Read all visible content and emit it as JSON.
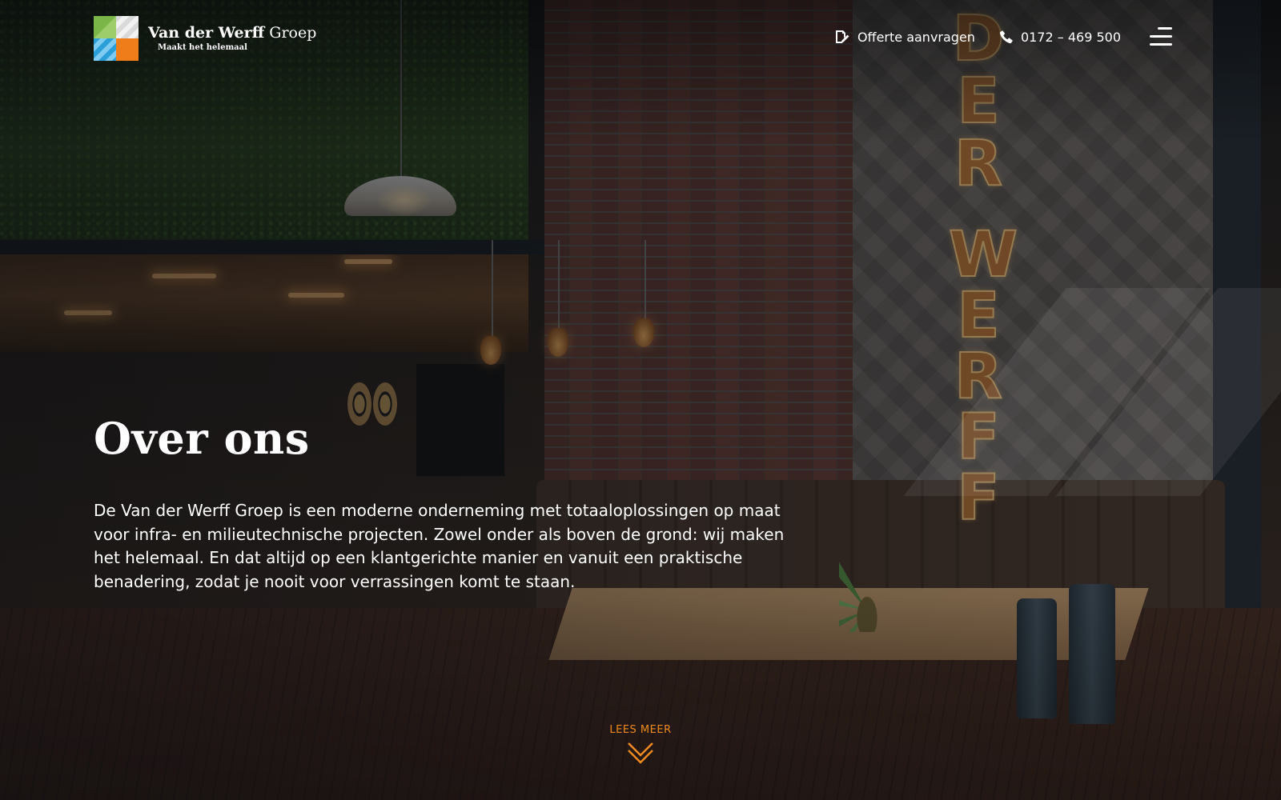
{
  "brand": {
    "name_bold": "Van der Werff",
    "name_regular": "Groep",
    "tagline": "Maakt het helemaal"
  },
  "nav": {
    "quote_label": "Offerte aanvragen",
    "quote_icon": "edit-document-icon",
    "phone_label": "0172 – 469 500",
    "phone_icon": "phone-icon",
    "menu_icon": "hamburger-menu-icon"
  },
  "hero": {
    "title": "Over ons",
    "intro": "De Van der Werff Groep is een moderne onderneming met totaaloplossingen op maat voor infra- en milieutechnische projecten. Zowel onder als boven de grond: wij maken het helemaal. En dat altijd op een klantgerichte manier en vanuit een praktische benadering, zodat je nooit voor verrassingen komt te staan.",
    "read_more_label": "LEES MEER",
    "read_more_icon": "double-chevron-down-icon"
  },
  "background_sign": {
    "word1": [
      "D",
      "E",
      "R"
    ],
    "word2": [
      "W",
      "E",
      "R",
      "F",
      "F"
    ]
  },
  "colors": {
    "accent_orange": "#ef8a1e",
    "logo_green": "#7ab648",
    "logo_blue": "#2b9fd9",
    "logo_orange": "#ef7d1a",
    "text_white": "#ffffff"
  }
}
